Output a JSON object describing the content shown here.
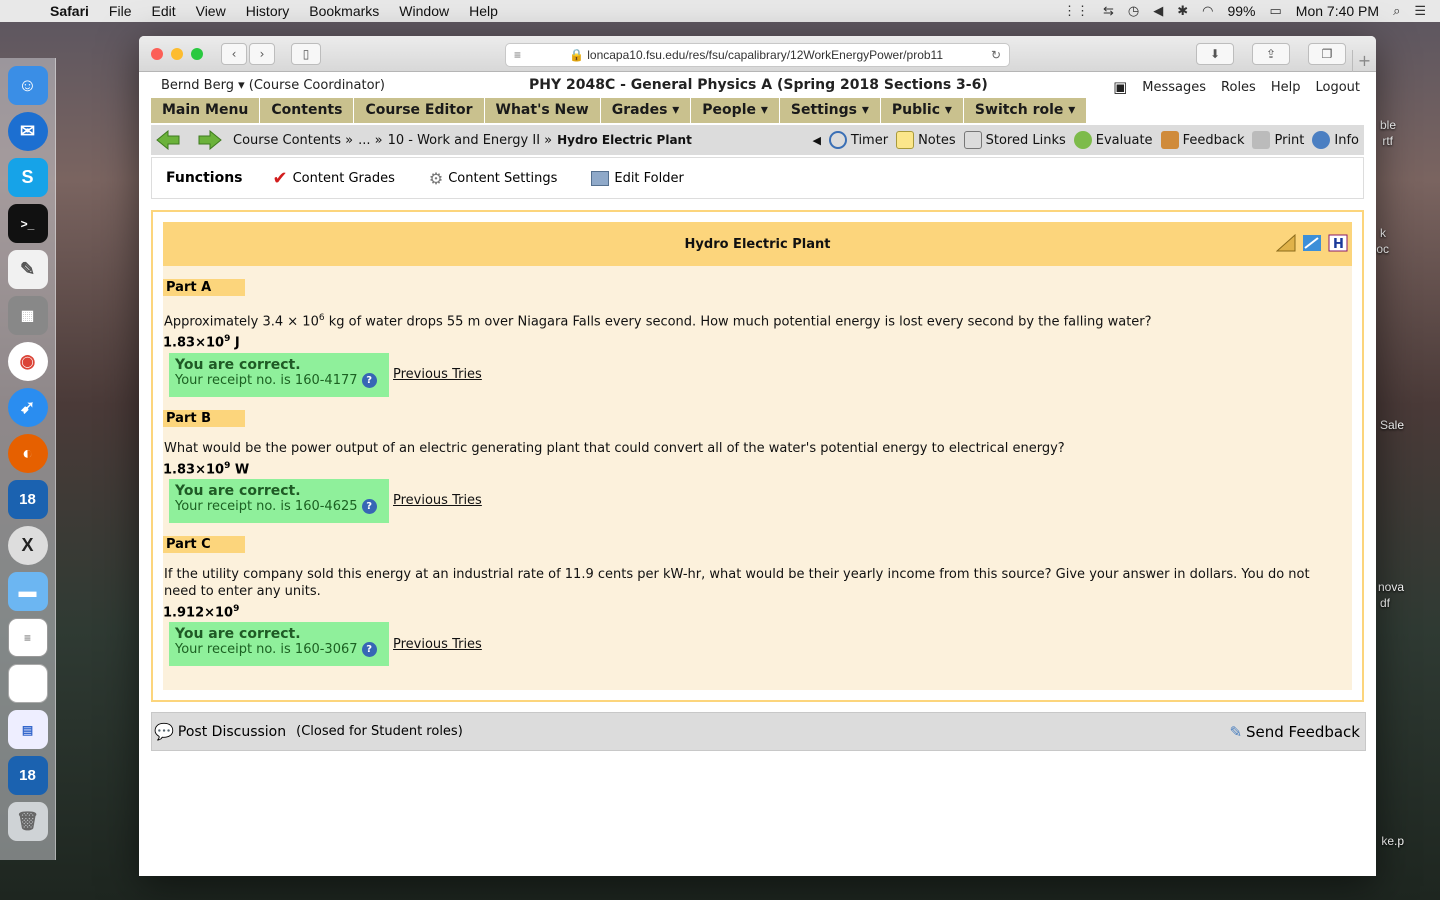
{
  "menubar": {
    "app": "Safari",
    "items": [
      "File",
      "Edit",
      "View",
      "History",
      "Bookmarks",
      "Window",
      "Help"
    ],
    "battery": "99%",
    "clock": "Mon 7:40 PM"
  },
  "desktop": {
    "labels": [
      "ble",
      "rtf",
      "k",
      "oc",
      "Sale",
      "nova",
      "df",
      "ke.p"
    ]
  },
  "browser": {
    "url": "loncapa10.fsu.edu/res/fsu/capalibrary/12WorkEnergyPower/prob11"
  },
  "lc": {
    "user": "Bernd Berg ▾",
    "role": "(Course Coordinator)",
    "course": "PHY 2048C - General Physics A (Spring 2018 Sections 3-6)",
    "links": [
      "Messages",
      "Roles",
      "Help",
      "Logout"
    ],
    "nav": [
      "Main Menu",
      "Contents",
      "Course Editor",
      "What's New",
      "Grades ▾",
      "People ▾",
      "Settings ▾",
      "Public ▾",
      "Switch role ▾"
    ],
    "crumbs": {
      "contents": "Course Contents »",
      "ellipsis": "... »",
      "folder": "10 - Work and Energy II »",
      "current": "Hydro Electric Plant"
    },
    "tools": [
      "Timer",
      "Notes",
      "Stored Links",
      "Evaluate",
      "Feedback",
      "Print",
      "Info"
    ],
    "functions": {
      "title": "Functions",
      "items": [
        "Content Grades",
        "Content Settings",
        "Edit Folder"
      ]
    },
    "problem": {
      "title": "Hydro Electric Plant",
      "parts": [
        {
          "label": "Part A",
          "question_pre": "Approximately 3.4 × 10",
          "question_sup": "6",
          "question_post": " kg of water drops 55 m over Niagara Falls every second. How much potential energy is lost every second by the falling water?",
          "answer_base": "1.83×10",
          "answer_sup": "9",
          "answer_unit": " J",
          "status": "You are correct.",
          "receipt": "Your receipt no. is 160-4177",
          "prev": "Previous Tries"
        },
        {
          "label": "Part B",
          "question_pre": "What would be the power output of an electric generating plant that could convert all of the water's potential energy to electrical energy?",
          "question_sup": "",
          "question_post": "",
          "answer_base": "1.83×10",
          "answer_sup": "9",
          "answer_unit": " W",
          "status": "You are correct.",
          "receipt": "Your receipt no. is 160-4625",
          "prev": "Previous Tries"
        },
        {
          "label": "Part C",
          "question_pre": "If the utility company sold this energy at an industrial rate of 11.9 cents per kW-hr, what would be their yearly income from this source? Give your answer in dollars. You do not need to enter any units.",
          "question_sup": "",
          "question_post": "",
          "answer_base": "1.912×10",
          "answer_sup": "9",
          "answer_unit": "",
          "status": "You are correct.",
          "receipt": "Your receipt no. is 160-3067",
          "prev": "Previous Tries"
        }
      ]
    },
    "discussion": {
      "post": "Post Discussion",
      "closed": "(Closed for Student roles)",
      "send": "Send Feedback"
    }
  }
}
